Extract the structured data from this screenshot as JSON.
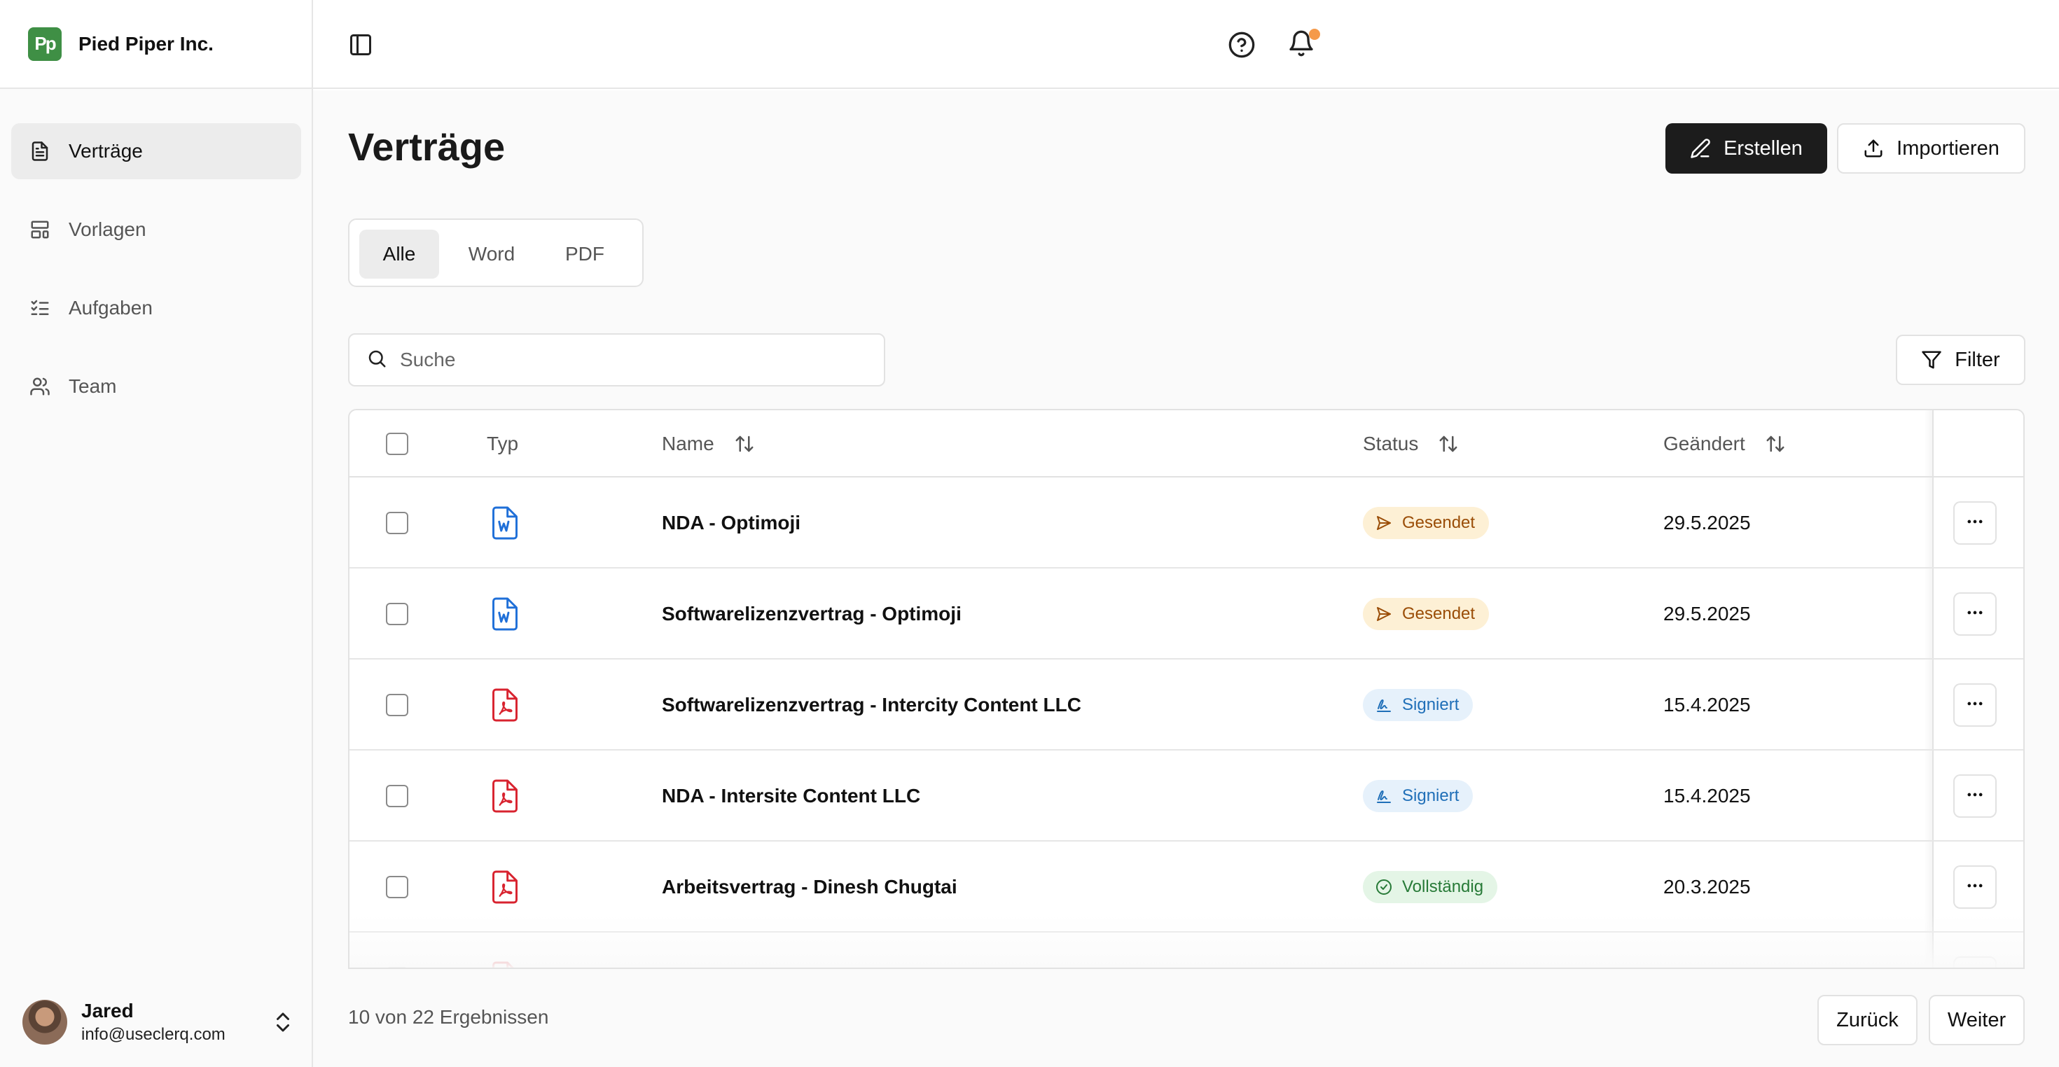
{
  "brand": {
    "logo_text": "Pp",
    "name": "Pied Piper Inc.",
    "logo_color": "#3f8f45"
  },
  "sidebar": {
    "items": [
      {
        "label": "Verträge",
        "icon": "document-icon",
        "active": true
      },
      {
        "label": "Vorlagen",
        "icon": "layout-template-icon",
        "active": false
      },
      {
        "label": "Aufgaben",
        "icon": "list-checks-icon",
        "active": false
      },
      {
        "label": "Team",
        "icon": "users-icon",
        "active": false
      }
    ]
  },
  "user": {
    "name": "Jared",
    "email": "info@useclerq.com"
  },
  "topbar": {
    "icons": [
      "sidebar-toggle-icon",
      "help-circle-icon",
      "bell-icon"
    ],
    "notification_dot_color": "#f59a4a"
  },
  "page": {
    "title": "Verträge"
  },
  "actions": {
    "create_label": "Erstellen",
    "import_label": "Importieren",
    "filter_label": "Filter"
  },
  "tabs": [
    {
      "label": "Alle",
      "active": true
    },
    {
      "label": "Word",
      "active": false
    },
    {
      "label": "PDF",
      "active": false
    }
  ],
  "search": {
    "placeholder": "Suche",
    "value": ""
  },
  "table": {
    "columns": {
      "type": "Typ",
      "name": "Name",
      "status": "Status",
      "changed": "Geändert"
    },
    "rows": [
      {
        "type": "word",
        "name": "NDA - Optimoji",
        "status": "Gesendet",
        "status_kind": "sent",
        "changed": "29.5.2025"
      },
      {
        "type": "word",
        "name": "Softwarelizenzvertrag - Optimoji",
        "status": "Gesendet",
        "status_kind": "sent",
        "changed": "29.5.2025"
      },
      {
        "type": "pdf",
        "name": "Softwarelizenzvertrag - Intercity Content LLC",
        "status": "Signiert",
        "status_kind": "signed",
        "changed": "15.4.2025"
      },
      {
        "type": "pdf",
        "name": "NDA - Intersite Content LLC",
        "status": "Signiert",
        "status_kind": "signed",
        "changed": "15.4.2025"
      },
      {
        "type": "pdf",
        "name": "Arbeitsvertrag - Dinesh Chugtai",
        "status": "Vollständig",
        "status_kind": "done",
        "changed": "20.3.2025"
      }
    ]
  },
  "pagination": {
    "summary": "10 von 22 Ergebnissen",
    "prev_label": "Zurück",
    "next_label": "Weiter"
  },
  "colors": {
    "word_icon": "#1f6fd8",
    "pdf_icon": "#d8232f",
    "primary_button": "#1c1c1c"
  }
}
